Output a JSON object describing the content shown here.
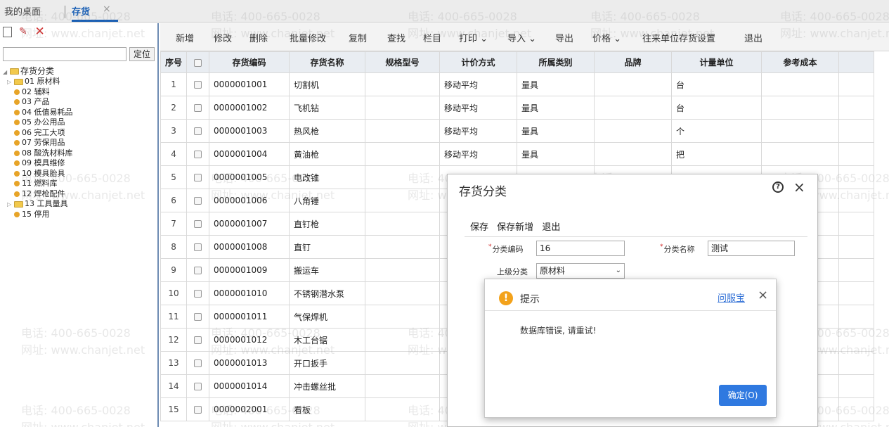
{
  "tabs": {
    "home": "我的桌面",
    "active": "存货",
    "close": "×"
  },
  "left": {
    "locate_button": "定位",
    "search_value": "",
    "tree": {
      "root": "存货分类",
      "items": [
        {
          "label": "01 原材料",
          "kind": "folder"
        },
        {
          "label": "02 辅料",
          "kind": "leaf"
        },
        {
          "label": "03 产品",
          "kind": "leaf"
        },
        {
          "label": "04 低值易耗品",
          "kind": "leaf"
        },
        {
          "label": "05 办公用品",
          "kind": "leaf"
        },
        {
          "label": "06 完工大项",
          "kind": "leaf"
        },
        {
          "label": "07 劳保用品",
          "kind": "leaf"
        },
        {
          "label": "08 酸洗材料库",
          "kind": "leaf"
        },
        {
          "label": "09 模具维修",
          "kind": "leaf"
        },
        {
          "label": "10 模具胎具",
          "kind": "leaf"
        },
        {
          "label": "11 燃料库",
          "kind": "leaf"
        },
        {
          "label": "12 焊枪配件",
          "kind": "leaf"
        },
        {
          "label": "13 工具量具",
          "kind": "folder"
        },
        {
          "label": "15 停用",
          "kind": "leaf"
        }
      ]
    }
  },
  "toolbar": {
    "items": [
      "新增",
      "修改",
      "删除",
      "批量修改",
      "复制",
      "查找",
      "栏目",
      "打印 ⌄",
      "导入 ⌄",
      "导出",
      "价格 ⌄",
      "往来单位存货设置",
      "退出"
    ]
  },
  "grid": {
    "headers": [
      "序号",
      "",
      "存货编码",
      "存货名称",
      "规格型号",
      "计价方式",
      "所属类别",
      "品牌",
      "计量单位",
      "参考成本"
    ],
    "rows": [
      [
        "1",
        "0000001001",
        "切割机",
        "",
        "移动平均",
        "量具",
        "",
        "台",
        ""
      ],
      [
        "2",
        "0000001002",
        "飞机钻",
        "",
        "移动平均",
        "量具",
        "",
        "台",
        ""
      ],
      [
        "3",
        "0000001003",
        "热风枪",
        "",
        "移动平均",
        "量具",
        "",
        "个",
        ""
      ],
      [
        "4",
        "0000001004",
        "黄油枪",
        "",
        "移动平均",
        "量具",
        "",
        "把",
        ""
      ],
      [
        "5",
        "0000001005",
        "电改锥",
        "",
        "",
        "",
        "",
        "",
        ""
      ],
      [
        "6",
        "0000001006",
        "八角锤",
        "",
        "",
        "",
        "",
        "",
        ""
      ],
      [
        "7",
        "0000001007",
        "直钉枪",
        "",
        "",
        "",
        "",
        "",
        ""
      ],
      [
        "8",
        "0000001008",
        "直钉",
        "",
        "",
        "",
        "",
        "",
        ""
      ],
      [
        "9",
        "0000001009",
        "搬运车",
        "",
        "",
        "",
        "",
        "",
        ""
      ],
      [
        "10",
        "0000001010",
        "不锈钢潜水泵",
        "",
        "",
        "",
        "",
        "",
        ""
      ],
      [
        "11",
        "0000001011",
        "气保焊机",
        "",
        "",
        "",
        "",
        "",
        ""
      ],
      [
        "12",
        "0000001012",
        "木工台锯",
        "",
        "",
        "",
        "",
        "",
        ""
      ],
      [
        "13",
        "0000001013",
        "开口扳手",
        "",
        "",
        "",
        "",
        "",
        ""
      ],
      [
        "14",
        "0000001014",
        "冲击螺丝批",
        "",
        "",
        "",
        "",
        "",
        ""
      ],
      [
        "15",
        "0000002001",
        "看板",
        "",
        "",
        "",
        "",
        "",
        ""
      ]
    ]
  },
  "dialog": {
    "title": "存货分类",
    "help": "?",
    "close": "×",
    "actions": [
      "保存",
      "保存新增",
      "退出"
    ],
    "code_label": "分类编码",
    "code_value": "16",
    "name_label": "分类名称",
    "name_value": "测试",
    "parent_label": "上级分类",
    "parent_value": "原材料"
  },
  "alert": {
    "icon": "!",
    "title": "提示",
    "link": "问服宝",
    "close": "×",
    "message": "数据库错误, 请重试!",
    "ok": "确定(O)"
  },
  "watermark": {
    "phone": "电话: 400-665-0028",
    "site": "网址: www.chanjet.net"
  },
  "colors": {
    "accent": "#1a5fb4",
    "ok_button": "#2f79e0",
    "warn": "#f3a21b"
  }
}
